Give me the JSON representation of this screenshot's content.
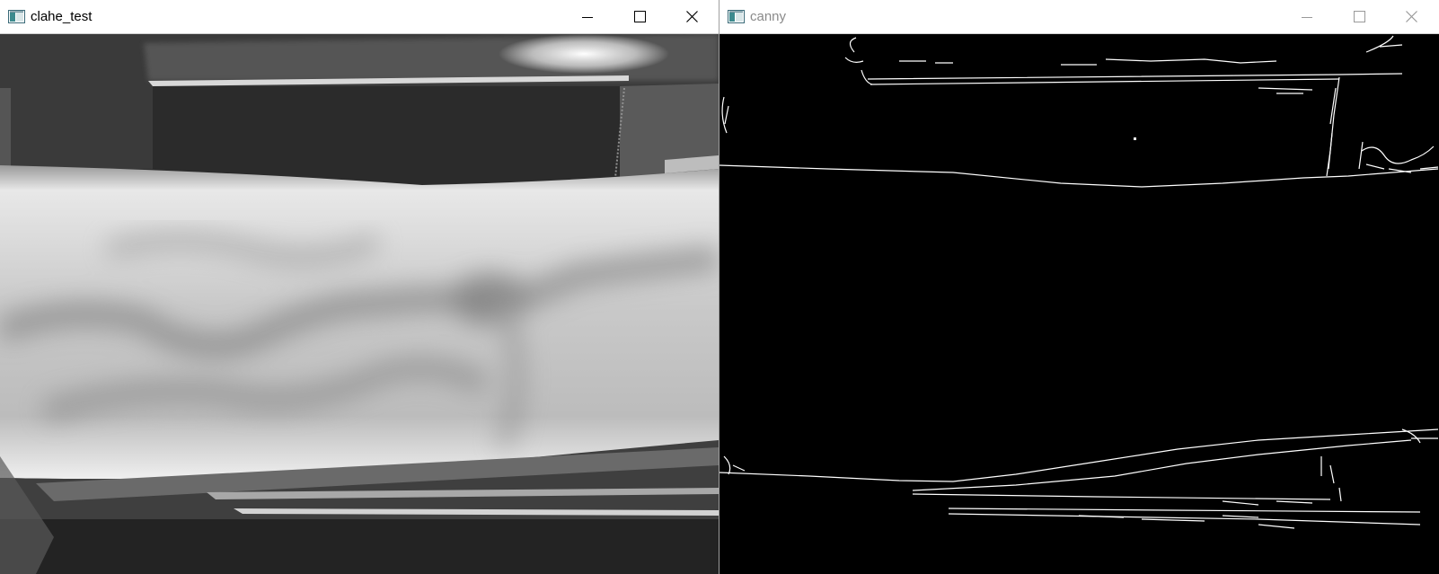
{
  "windows": [
    {
      "title": "clahe_test",
      "active": true
    },
    {
      "title": "canny",
      "active": false
    }
  ],
  "icons": {
    "app": "opencv-window-icon",
    "minimize": "minimize-icon",
    "maximize": "maximize-icon",
    "close": "close-icon"
  },
  "colors": {
    "title_active": "#000000",
    "title_inactive": "#8a8a8a",
    "edge_background": "#000000",
    "edge_lines": "#ffffff"
  }
}
